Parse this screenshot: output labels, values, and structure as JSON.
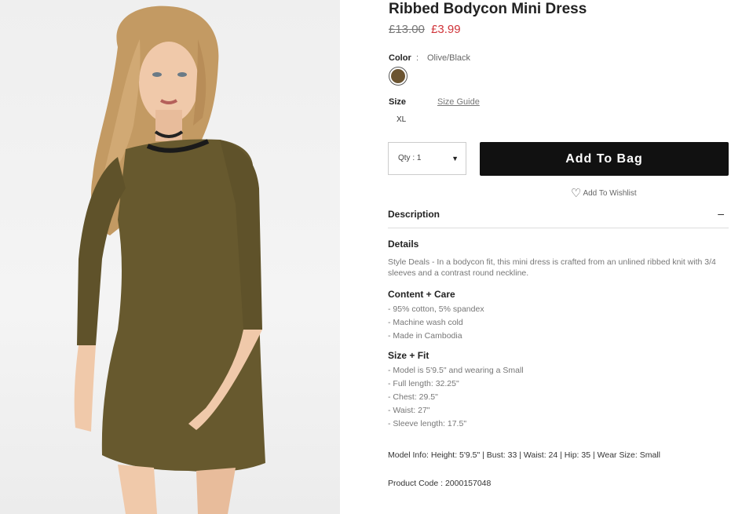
{
  "product": {
    "title": "Ribbed Bodycon Mini Dress",
    "old_price": "£13.00",
    "price": "£3.99",
    "image_icon": "model-wearing-dress-photo"
  },
  "color": {
    "label": "Color",
    "separator": ":",
    "value": "Olive/Black",
    "swatch_color": "#6b5431"
  },
  "size": {
    "label": "Size",
    "guide_label": "Size Guide",
    "selected": "XL"
  },
  "quantity": {
    "label": "Qty : 1",
    "caret": "▼"
  },
  "buttons": {
    "add_to_bag": "Add To Bag",
    "wishlist": "Add To Wishlist",
    "wishlist_icon": "♡"
  },
  "description": {
    "heading": "Description",
    "toggle": "–",
    "details_title": "Details",
    "details_text": "Style Deals - In a bodycon fit, this mini dress is crafted from an unlined ribbed knit with 3/4 sleeves and a contrast round neckline.",
    "content_title": "Content + Care",
    "content_items": [
      "- 95% cotton, 5% spandex",
      "- Machine wash cold",
      "- Made in Cambodia"
    ],
    "fit_title": "Size + Fit",
    "fit_items": [
      "- Model is 5'9.5\" and wearing a Small",
      "- Full length: 32.25\"",
      "- Chest: 29.5\"",
      "- Waist: 27\"",
      "- Sleeve length: 17.5\""
    ],
    "model_info": "Model Info: Height: 5'9.5\" | Bust: 33 | Waist: 24 | Hip: 35 | Wear Size: Small",
    "product_code": "Product Code : 2000157048"
  }
}
